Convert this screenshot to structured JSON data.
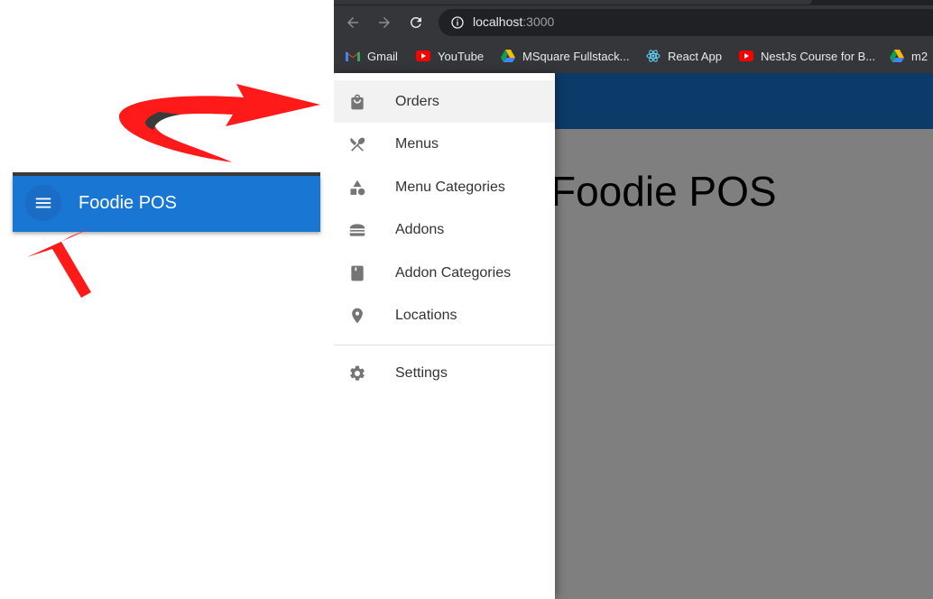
{
  "left_panel": {
    "app_title": "Foodie POS",
    "menu_icon": "hamburger-menu-icon"
  },
  "browser": {
    "url_host": "localhost",
    "url_port": ":3000",
    "bookmarks": [
      {
        "label": "Gmail",
        "icon": "gmail-icon"
      },
      {
        "label": "YouTube",
        "icon": "youtube-icon"
      },
      {
        "label": "MSquare Fullstack...",
        "icon": "google-drive-icon"
      },
      {
        "label": "React App",
        "icon": "react-icon"
      },
      {
        "label": "NestJs Course for B...",
        "icon": "youtube-icon"
      },
      {
        "label": "m2",
        "icon": "google-drive-icon"
      }
    ]
  },
  "page": {
    "title": "Foodie POS"
  },
  "drawer": {
    "items": [
      {
        "label": "Orders",
        "icon": "shopping-bag-icon",
        "selected": true
      },
      {
        "label": "Menus",
        "icon": "restaurant-utensils-icon"
      },
      {
        "label": "Menu Categories",
        "icon": "category-shapes-icon"
      },
      {
        "label": "Addons",
        "icon": "burger-icon"
      },
      {
        "label": "Addon Categories",
        "icon": "book-icon"
      },
      {
        "label": "Locations",
        "icon": "location-pin-icon"
      }
    ],
    "settings": {
      "label": "Settings",
      "icon": "settings-gear-icon"
    }
  },
  "colors": {
    "primary": "#1976d2",
    "arrow": "#ff0000",
    "browser_chrome": "#35363a"
  }
}
